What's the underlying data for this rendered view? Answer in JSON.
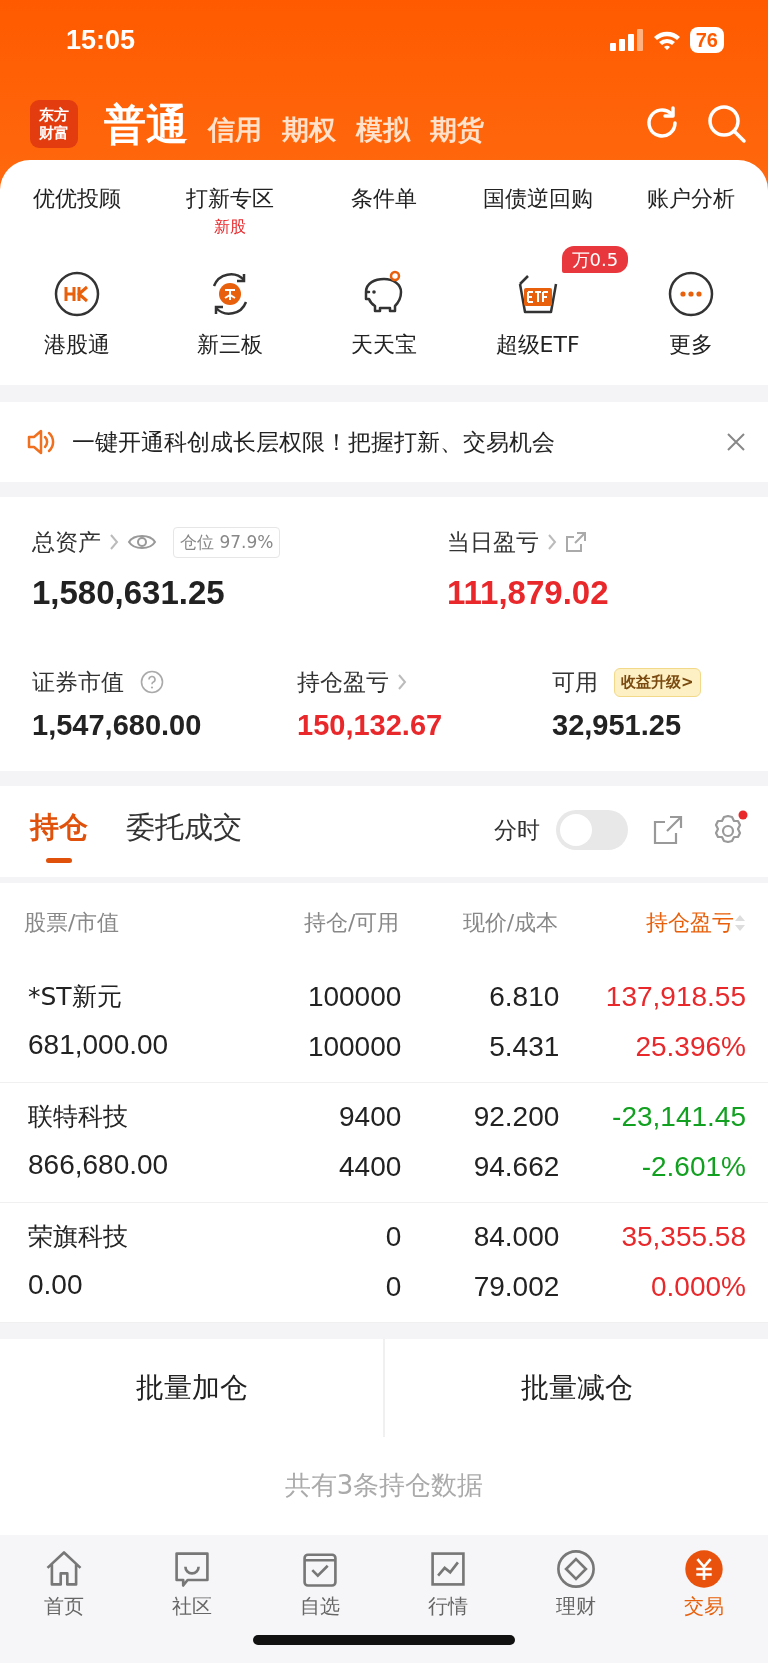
{
  "status_bar": {
    "time": "15:05",
    "battery": "76"
  },
  "header": {
    "logo": [
      "东方",
      "财富"
    ],
    "tabs": [
      {
        "label": "普通",
        "selected": true
      },
      {
        "label": "信用",
        "selected": false
      },
      {
        "label": "期权",
        "selected": false
      },
      {
        "label": "模拟",
        "selected": false
      },
      {
        "label": "期货",
        "selected": false
      }
    ]
  },
  "quick_menu": [
    [
      {
        "label": "优优投顾"
      },
      {
        "label": "打新专区",
        "sub": "新股"
      },
      {
        "label": "条件单"
      },
      {
        "label": "国债逆回购"
      },
      {
        "label": "账户分析"
      }
    ],
    [
      {
        "label": "港股通",
        "kind": "hk"
      },
      {
        "label": "新三板",
        "kind": "new"
      },
      {
        "label": "天天宝",
        "kind": "piggy"
      },
      {
        "label": "超级ETF",
        "kind": "etf",
        "badge": "万0.5"
      },
      {
        "label": "更多",
        "kind": "more"
      }
    ]
  ],
  "banner": {
    "text": "一键开通科创成长层权限！把握打新、交易机会"
  },
  "assets": {
    "total_label": "总资产",
    "position_label": "仓位",
    "position_value": "97.9%",
    "total_value": "1,580,631.25",
    "daily_label": "当日盈亏",
    "daily_value": "111,879.02",
    "market_label": "证券市值",
    "market_value": "1,547,680.00",
    "holding_label": "持仓盈亏",
    "holding_value": "150,132.67",
    "available_label": "可用",
    "upgrade_badge": "收益升级>",
    "available_value": "32,951.25"
  },
  "holdings": {
    "tabs": [
      {
        "label": "持仓",
        "selected": true
      },
      {
        "label": "委托成交",
        "selected": false
      }
    ],
    "toggle": {
      "label": "分时",
      "on": false
    },
    "settings_notice": true,
    "columns": [
      {
        "label": "股票/市值",
        "sorted": false
      },
      {
        "label": "持仓/可用",
        "sorted": false
      },
      {
        "label": "现价/成本",
        "sorted": false
      },
      {
        "label": "持仓盈亏",
        "sorted": true
      }
    ],
    "rows": [
      {
        "name": "*ST新元",
        "market_value": "681,000.00",
        "holding": "100000",
        "available": "100000",
        "price": "6.810",
        "cost": "5.431",
        "pl": "137,918.55",
        "pl_pct": "25.396%",
        "color": "#e8282b"
      },
      {
        "name": "联特科技",
        "market_value": "866,680.00",
        "holding": "9400",
        "available": "4400",
        "price": "92.200",
        "cost": "94.662",
        "pl": "-23,141.45",
        "pl_pct": "-2.601%",
        "color": "#12a020"
      },
      {
        "name": "荣旗科技",
        "market_value": "0.00",
        "holding": "0",
        "available": "0",
        "price": "84.000",
        "cost": "79.002",
        "pl": "35,355.58",
        "pl_pct": "0.000%",
        "color": "#e8282b"
      }
    ]
  },
  "batch_buttons": [
    "批量加仓",
    "批量减仓"
  ],
  "summary": "共有3条持仓数据",
  "bottom_nav": [
    {
      "label": "首页",
      "kind": "home",
      "selected": false
    },
    {
      "label": "社区",
      "kind": "community",
      "selected": false
    },
    {
      "label": "自选",
      "kind": "watchlist",
      "selected": false
    },
    {
      "label": "行情",
      "kind": "market",
      "selected": false
    },
    {
      "label": "理财",
      "kind": "wealth",
      "selected": false
    },
    {
      "label": "交易",
      "kind": "trade",
      "selected": true
    }
  ]
}
